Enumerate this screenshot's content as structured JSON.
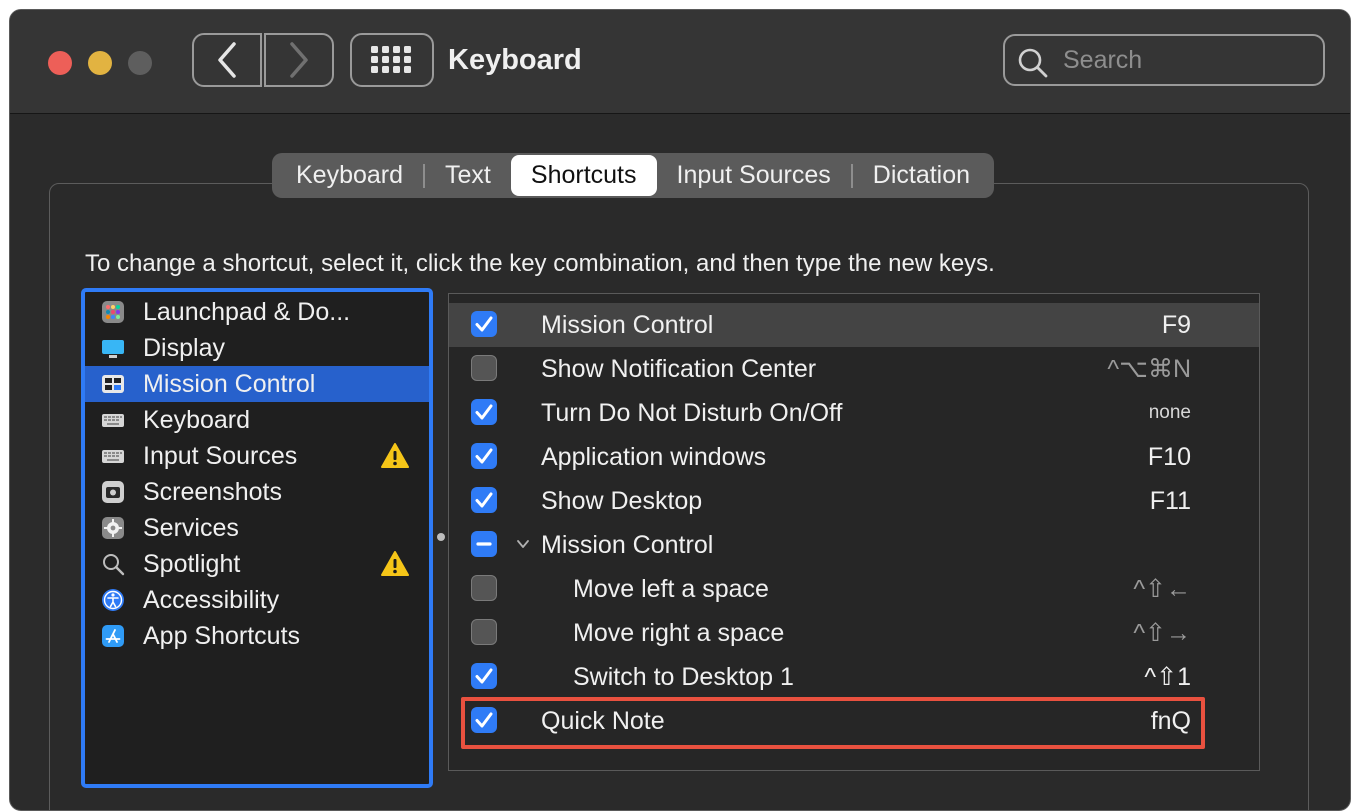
{
  "window": {
    "title": "Keyboard",
    "search_placeholder": "Search"
  },
  "tabs": [
    {
      "label": "Keyboard",
      "active": false
    },
    {
      "label": "Text",
      "active": false
    },
    {
      "label": "Shortcuts",
      "active": true
    },
    {
      "label": "Input Sources",
      "active": false
    },
    {
      "label": "Dictation",
      "active": false
    }
  ],
  "instructions": "To change a shortcut, select it, click the key combination, and then type the new keys.",
  "sidebar": {
    "items": [
      {
        "label": "Launchpad & Do...",
        "icon": "launchpad-icon",
        "selected": false,
        "warning": false
      },
      {
        "label": "Display",
        "icon": "display-icon",
        "selected": false,
        "warning": false
      },
      {
        "label": "Mission Control",
        "icon": "mission-control-icon",
        "selected": true,
        "warning": false
      },
      {
        "label": "Keyboard",
        "icon": "keyboard-icon",
        "selected": false,
        "warning": false
      },
      {
        "label": "Input Sources",
        "icon": "keyboard-icon",
        "selected": false,
        "warning": true
      },
      {
        "label": "Screenshots",
        "icon": "screenshot-icon",
        "selected": false,
        "warning": false
      },
      {
        "label": "Services",
        "icon": "gear-icon",
        "selected": false,
        "warning": false
      },
      {
        "label": "Spotlight",
        "icon": "magnifier-icon",
        "selected": false,
        "warning": true
      },
      {
        "label": "Accessibility",
        "icon": "accessibility-icon",
        "selected": false,
        "warning": false
      },
      {
        "label": "App Shortcuts",
        "icon": "app-store-icon",
        "selected": false,
        "warning": false
      }
    ]
  },
  "shortcuts": {
    "rows": [
      {
        "label": "Mission Control",
        "state": "checked",
        "key": "F9",
        "indent": 0,
        "selected": true
      },
      {
        "label": "Show Notification Center",
        "state": "unchecked",
        "key": "^⌥⌘N",
        "indent": 0,
        "selected": false
      },
      {
        "label": "Turn Do Not Disturb On/Off",
        "state": "checked",
        "key": "none",
        "indent": 0,
        "selected": false
      },
      {
        "label": "Application windows",
        "state": "checked",
        "key": "F10",
        "indent": 0,
        "selected": false
      },
      {
        "label": "Show Desktop",
        "state": "checked",
        "key": "F11",
        "indent": 0,
        "selected": false
      },
      {
        "label": "Mission Control",
        "state": "mixed",
        "key": "",
        "indent": 0,
        "selected": false,
        "disclosure": true
      },
      {
        "label": "Move left a space",
        "state": "unchecked",
        "key": "^⇧←",
        "indent": 1,
        "selected": false
      },
      {
        "label": "Move right a space",
        "state": "unchecked",
        "key": "^⇧→",
        "indent": 1,
        "selected": false
      },
      {
        "label": "Switch to Desktop 1",
        "state": "checked",
        "key": "^⇧1",
        "indent": 1,
        "selected": false
      },
      {
        "label": "Quick Note",
        "state": "checked",
        "key": "fnQ",
        "indent": 0,
        "selected": false,
        "highlighted": true
      }
    ]
  },
  "colors": {
    "accent": "#2f7bf6",
    "highlight_box": "#e9513f",
    "warning": "#f5c518"
  }
}
